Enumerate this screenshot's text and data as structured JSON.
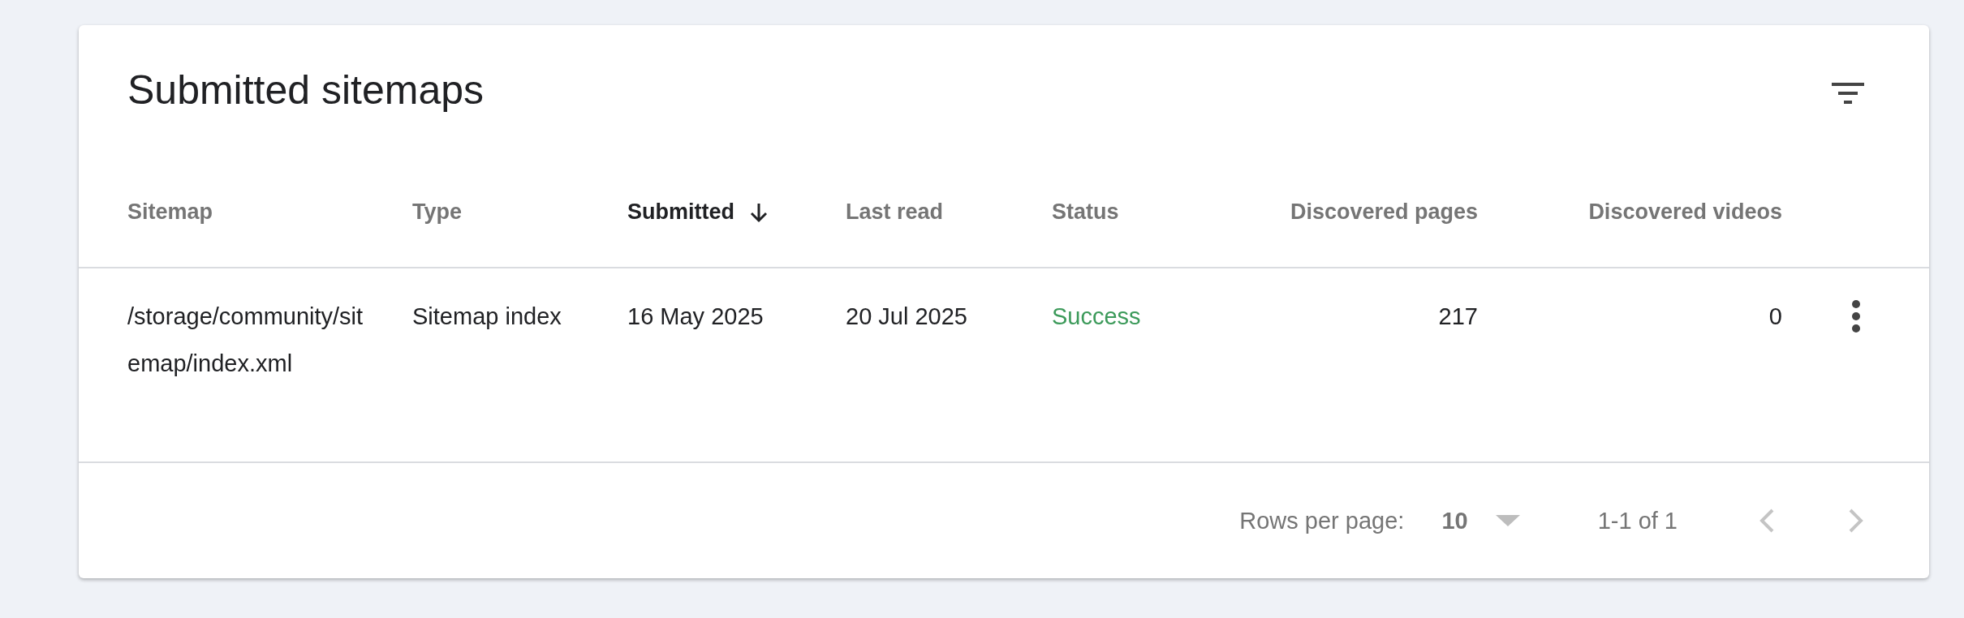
{
  "card": {
    "title": "Submitted sitemaps"
  },
  "table": {
    "columns": [
      {
        "label": "Sitemap",
        "sorted": false
      },
      {
        "label": "Type",
        "sorted": false
      },
      {
        "label": "Submitted",
        "sorted": true
      },
      {
        "label": "Last read",
        "sorted": false
      },
      {
        "label": "Status",
        "sorted": false
      },
      {
        "label": "Discovered pages",
        "sorted": false
      },
      {
        "label": "Discovered videos",
        "sorted": false
      }
    ],
    "rows": [
      {
        "sitemap": "/storage/community/sitemap/index.xml",
        "type": "Sitemap index",
        "submitted": "16 May 2025",
        "last_read": "20 Jul 2025",
        "status": {
          "text": "Success",
          "kind": "success"
        },
        "discovered_pages": "217",
        "discovered_videos": "0"
      }
    ]
  },
  "pagination": {
    "rows_per_page_label": "Rows per page:",
    "rows_per_page": "10",
    "range": "1-1 of 1",
    "previous_disabled": true,
    "next_disabled": true
  }
}
